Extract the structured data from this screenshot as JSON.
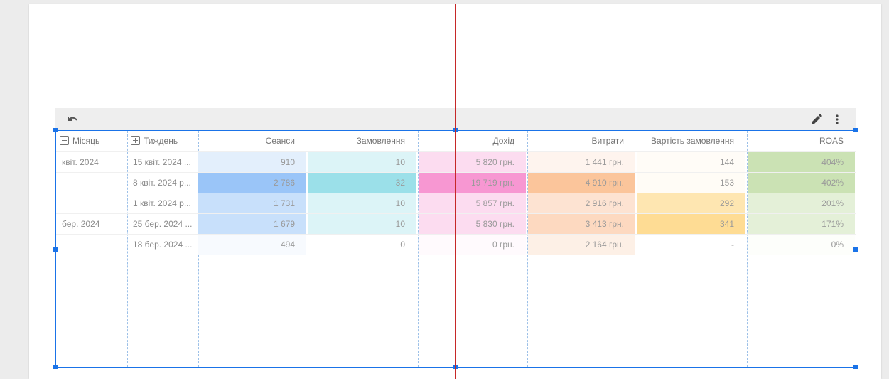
{
  "toolbar": {
    "undo_icon": "undo-icon",
    "edit_icon": "pencil-icon",
    "more_icon": "more-vert-icon"
  },
  "table": {
    "headers": {
      "month": "Місяць",
      "week": "Тиждень",
      "sessions": "Сеанси",
      "orders": "Замовлення",
      "revenue": "Дохід",
      "costs": "Витрати",
      "order_value": "Вартість замовлення",
      "roas": "ROAS"
    },
    "rows": [
      {
        "month": "квіт. 2024",
        "week": "15 квіт. 2024 ...",
        "sessions": "910",
        "orders": "10",
        "revenue": "5 820 грн.",
        "costs": "1 441 грн.",
        "order_value": "144",
        "roas": "404%"
      },
      {
        "month": "",
        "week": "8 квіт. 2024 р...",
        "sessions": "2 786",
        "orders": "32",
        "revenue": "19 719 грн.",
        "costs": "4 910 грн.",
        "order_value": "153",
        "roas": "402%"
      },
      {
        "month": "",
        "week": "1 квіт. 2024 р...",
        "sessions": "1 731",
        "orders": "10",
        "revenue": "5 857 грн.",
        "costs": "2 916 грн.",
        "order_value": "292",
        "roas": "201%"
      },
      {
        "month": "бер. 2024",
        "week": "25 бер. 2024 ...",
        "sessions": "1 679",
        "orders": "10",
        "revenue": "5 830 грн.",
        "costs": "3 413 грн.",
        "order_value": "341",
        "roas": "171%"
      },
      {
        "month": "",
        "week": "18 бер. 2024 ...",
        "sessions": "494",
        "orders": "0",
        "revenue": "0 грн.",
        "costs": "2 164 грн.",
        "order_value": "-",
        "roas": "0%"
      }
    ],
    "heatmap_colors": {
      "sessions": [
        "#e3effc",
        "#9ac5f8",
        "#c8e0fb",
        "#c8e0fb",
        "#f7fafe"
      ],
      "orders": [
        "#dcf4f7",
        "#9be0e9",
        "#dcf4f7",
        "#dcf4f7",
        "#ffffff"
      ],
      "revenue": [
        "#fcdcf0",
        "#f797d2",
        "#fcdcf0",
        "#fcdcf0",
        "#fffafd"
      ],
      "costs": [
        "#fef4ee",
        "#fbc59b",
        "#fde3d2",
        "#fdd9c0",
        "#fdf0e6"
      ],
      "order_value": [
        "#fffcf7",
        "#fffcf6",
        "#fee6b1",
        "#fedc94",
        "#ffffff"
      ],
      "roas": [
        "#cbe2b4",
        "#cbe2b4",
        "#e4f0d8",
        "#e4f0d8",
        "#fdfefb"
      ]
    }
  }
}
